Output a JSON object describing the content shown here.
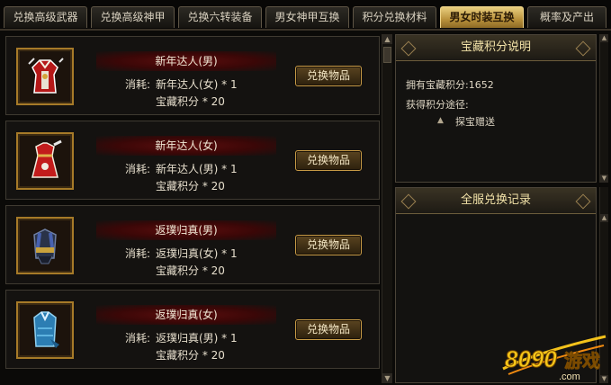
{
  "tabs": [
    {
      "label": "兑换高级武器",
      "active": false
    },
    {
      "label": "兑换高级神甲",
      "active": false
    },
    {
      "label": "兑换六转装备",
      "active": false
    },
    {
      "label": "男女神甲互换",
      "active": false
    },
    {
      "label": "积分兑换材料",
      "active": false
    },
    {
      "label": "男女时装互换",
      "active": true
    },
    {
      "label": "概率及产出",
      "active": false
    }
  ],
  "cost_label": "消耗:",
  "items": [
    {
      "name": "新年达人(男)",
      "cost_item": "新年达人(女) * 1",
      "cost_points": "宝藏积分 * 20",
      "button": "兑换物品",
      "icon": "festive-robe-icon"
    },
    {
      "name": "新年达人(女)",
      "cost_item": "新年达人(男) * 1",
      "cost_points": "宝藏积分 * 20",
      "button": "兑换物品",
      "icon": "festive-dress-icon"
    },
    {
      "name": "返璞归真(男)",
      "cost_item": "返璞归真(女) * 1",
      "cost_points": "宝藏积分 * 20",
      "button": "兑换物品",
      "icon": "dark-armor-icon"
    },
    {
      "name": "返璞归真(女)",
      "cost_item": "返璞归真(男) * 1",
      "cost_points": "宝藏积分 * 20",
      "button": "兑换物品",
      "icon": "blue-robe-icon"
    }
  ],
  "info_panel": {
    "title": "宝藏积分说明",
    "points_line": "拥有宝藏积分:1652",
    "source_title": "获得积分途径:",
    "source_item": "探宝赠送"
  },
  "record_panel": {
    "title": "全服兑换记录"
  },
  "watermark": {
    "number": "8090",
    "text": "游戏",
    "domain": ".com"
  }
}
